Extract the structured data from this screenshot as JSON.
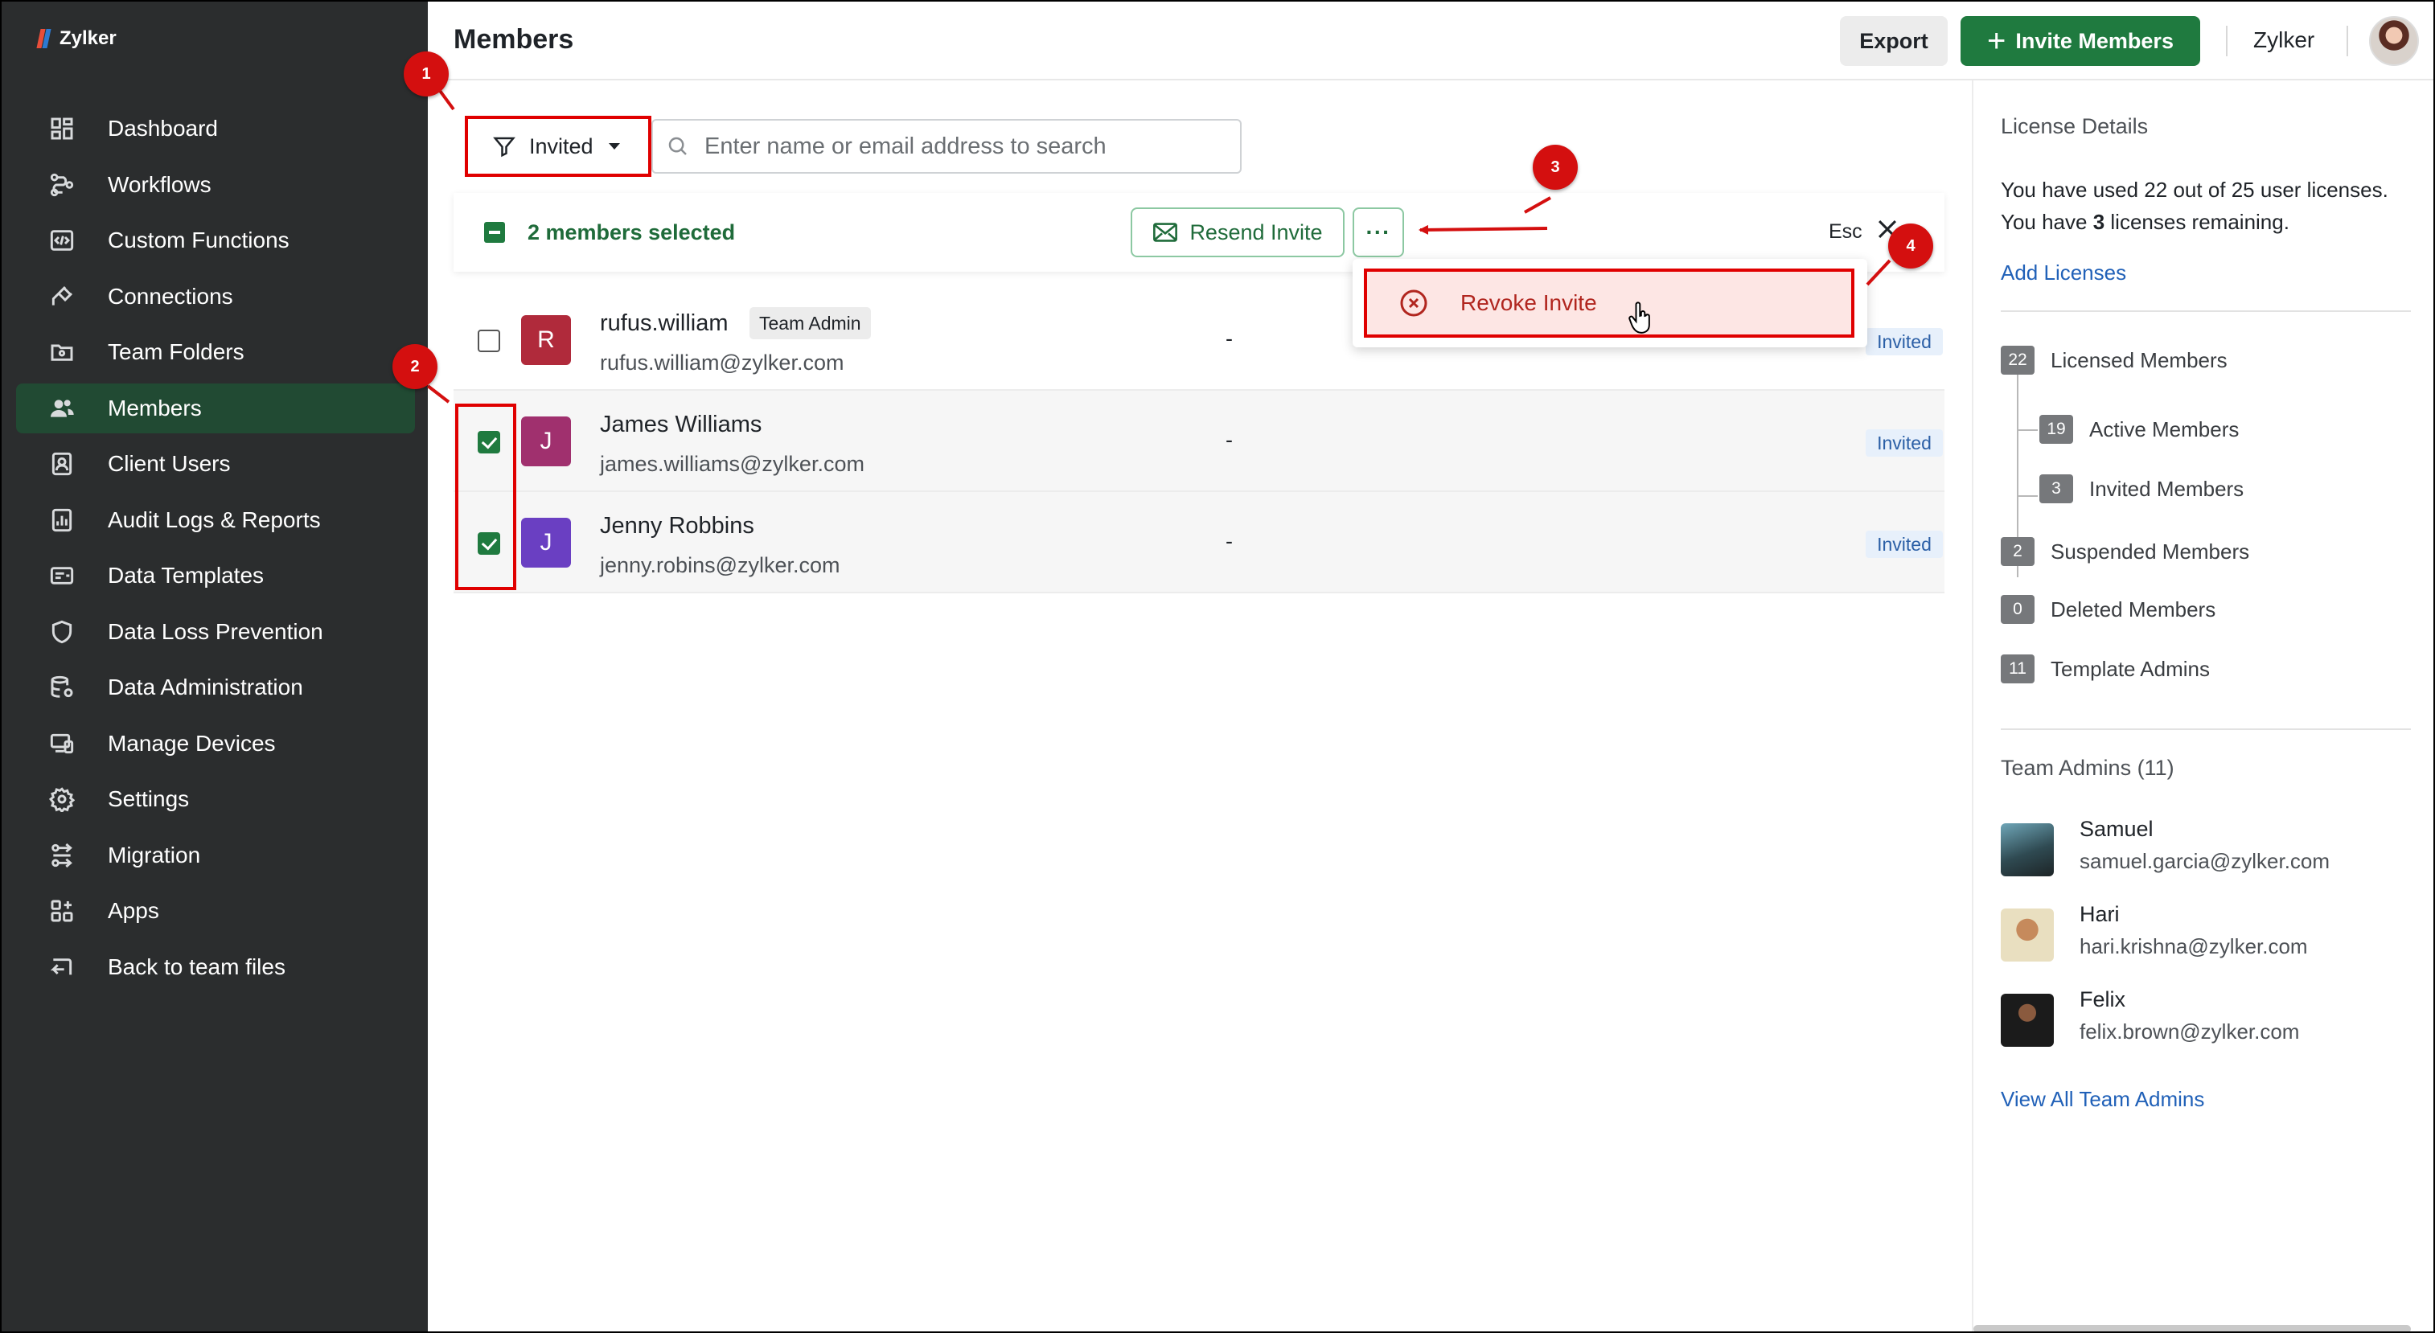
{
  "app": {
    "name": "Zylker"
  },
  "sidebar": {
    "items": [
      {
        "label": "Dashboard",
        "icon": "dashboard-icon"
      },
      {
        "label": "Workflows",
        "icon": "workflow-icon"
      },
      {
        "label": "Custom Functions",
        "icon": "code-icon"
      },
      {
        "label": "Connections",
        "icon": "plug-icon"
      },
      {
        "label": "Team Folders",
        "icon": "folder-icon"
      },
      {
        "label": "Members",
        "icon": "users-icon",
        "active": true
      },
      {
        "label": "Client Users",
        "icon": "client-user-icon"
      },
      {
        "label": "Audit Logs & Reports",
        "icon": "report-icon"
      },
      {
        "label": "Data Templates",
        "icon": "template-icon"
      },
      {
        "label": "Data Loss Prevention",
        "icon": "shield-icon"
      },
      {
        "label": "Data Administration",
        "icon": "database-icon"
      },
      {
        "label": "Manage Devices",
        "icon": "devices-icon"
      },
      {
        "label": "Settings",
        "icon": "gear-icon"
      },
      {
        "label": "Migration",
        "icon": "migration-icon"
      },
      {
        "label": "Apps",
        "icon": "apps-icon"
      },
      {
        "label": "Back to team files",
        "icon": "back-icon"
      }
    ]
  },
  "header": {
    "title": "Members",
    "export_label": "Export",
    "invite_label": "Invite Members",
    "org_name": "Zylker"
  },
  "filter": {
    "label": "Invited"
  },
  "search": {
    "placeholder": "Enter name or email address to search"
  },
  "selection": {
    "text": "2 members selected",
    "resend_label": "Resend Invite",
    "more_label": "···",
    "esc_label": "Esc"
  },
  "members": [
    {
      "initial": "R",
      "name": "rufus.william",
      "badge": "Team Admin",
      "email": "rufus.william@zylker.com",
      "dash": "-",
      "status": "Invited",
      "checked": false,
      "color": "#b02a3b"
    },
    {
      "initial": "J",
      "name": "James Williams",
      "badge": "",
      "email": "james.williams@zylker.com",
      "dash": "-",
      "status": "Invited",
      "checked": true,
      "color": "#a0306e"
    },
    {
      "initial": "J",
      "name": "Jenny Robbins",
      "badge": "",
      "email": "jenny.robins@zylker.com",
      "dash": "-",
      "status": "Invited",
      "checked": true,
      "color": "#6a3fc2"
    }
  ],
  "dropdown": {
    "revoke_label": "Revoke Invite"
  },
  "callouts": [
    "1",
    "2",
    "3",
    "4"
  ],
  "license": {
    "heading": "License Details",
    "line1": "You have used 22 out of 25 user licenses.",
    "line2_pre": "You have ",
    "line2_num": "3",
    "line2_post": " licenses remaining.",
    "add_link": "Add Licenses",
    "stats": [
      {
        "num": "22",
        "label": "Licensed Members"
      },
      {
        "num": "19",
        "label": "Active Members"
      },
      {
        "num": "3",
        "label": "Invited Members"
      },
      {
        "num": "2",
        "label": "Suspended Members"
      },
      {
        "num": "0",
        "label": "Deleted Members"
      },
      {
        "num": "11",
        "label": "Template Admins"
      }
    ]
  },
  "team_admins": {
    "heading": "Team Admins (11)",
    "list": [
      {
        "name": "Samuel",
        "email": "samuel.garcia@zylker.com"
      },
      {
        "name": "Hari",
        "email": "hari.krishna@zylker.com"
      },
      {
        "name": "Felix",
        "email": "felix.brown@zylker.com"
      }
    ],
    "view_all": "View All Team Admins"
  },
  "colors": {
    "sidebar_bg": "#2b2d2e",
    "active_nav": "#214a33",
    "accent_green": "#1f7a3f",
    "annotation_red": "#e00000",
    "link_blue": "#2161b8"
  }
}
